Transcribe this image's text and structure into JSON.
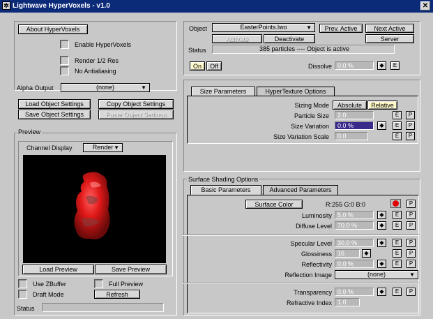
{
  "window": {
    "title": "Lightwave HyperVoxels - v1.0",
    "close_glyph": "✕"
  },
  "left": {
    "about_button": "About HyperVoxels",
    "enable_label": "Enable HyperVoxels",
    "render_half_label": "Render 1/2 Res",
    "no_aa_label": "No Antialiasing",
    "alpha_output_label": "Alpha Output",
    "alpha_output_value": "(none)",
    "load_obj_button": "Load Object Settings",
    "copy_obj_button": "Copy Object Settings",
    "save_obj_button": "Save Object Settings",
    "paste_obj_button": "Paste Object Settings"
  },
  "preview": {
    "group_label": "Preview",
    "channel_label": "Channel Display",
    "channel_value": "Render",
    "load_button": "Load Preview",
    "save_button": "Save Preview",
    "zbuffer_label": "Use ZBuffer",
    "full_label": "Full Preview",
    "draft_label": "Draft Mode",
    "refresh_button": "Refresh",
    "status_label": "Status",
    "status_value": ""
  },
  "object": {
    "object_label": "Object",
    "object_value": "EasterPoints.lwo",
    "prev_button": "Prev. Active",
    "next_button": "Next Active",
    "activate_button": "Activate",
    "deactivate_button": "Deactivate",
    "server_button": "Server",
    "status_label": "Status",
    "status_value": "385 particles ---- Object is active",
    "on_label": "On",
    "off_label": "Off",
    "dissolve_label": "Dissolve",
    "dissolve_value": "0.0 %",
    "e_label": "E"
  },
  "size_tabs": {
    "size_params": "Size Parameters",
    "hypertexture": "HyperTexture Options"
  },
  "size": {
    "sizing_mode_label": "Sizing Mode",
    "absolute": "Absolute",
    "relative": "Relative",
    "particle_size_label": "Particle Size",
    "particle_size_value": "2.0",
    "size_variation_label": "Size Variation",
    "size_variation_value": "0.0 %",
    "size_variation_scale_label": "Size Variation Scale",
    "size_variation_scale_value": "0.0",
    "e": "E",
    "p": "P"
  },
  "shading": {
    "group_label": "Surface Shading Options",
    "tab_basic": "Basic Parameters",
    "tab_advanced": "Advanced Parameters",
    "surface_color_button": "Surface Color",
    "color_value": "R:255  G:0    B:0",
    "color_swatch": "#e00000",
    "luminosity_label": "Luminosity",
    "luminosity_value": "5.0 %",
    "diffuse_label": "Diffuse Level",
    "diffuse_value": "70.0 %",
    "specular_label": "Specular Level",
    "specular_value": "30.0 %",
    "glossiness_label": "Glossiness",
    "glossiness_value": "16",
    "reflectivity_label": "Reflectivity",
    "reflectivity_value": "0.0 %",
    "reflection_image_label": "Reflection Image",
    "reflection_image_value": "(none)",
    "transparency_label": "Transparency",
    "transparency_value": "0.0 %",
    "refractive_label": "Refractive Index",
    "refractive_value": "1.0",
    "e": "E",
    "p": "P",
    "arrows_glyph": "◆"
  }
}
